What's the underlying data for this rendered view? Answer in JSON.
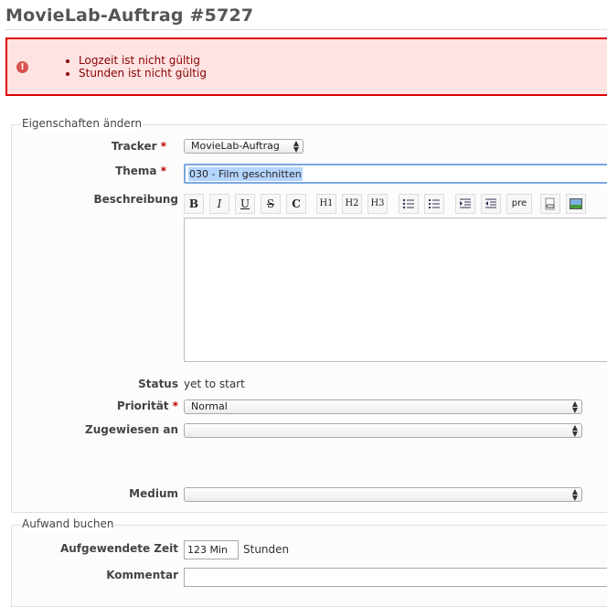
{
  "page": {
    "title": "MovieLab-Auftrag #5727"
  },
  "errors": [
    "Logzeit ist nicht gültig",
    "Stunden ist nicht gültig"
  ],
  "properties": {
    "legend": "Eigenschaften ändern",
    "tracker": {
      "label": "Tracker",
      "value": "MovieLab-Auftrag"
    },
    "subject": {
      "label": "Thema",
      "value": "030 - Film geschnitten"
    },
    "description": {
      "label": "Beschreibung",
      "value": ""
    },
    "toolbar": [
      "B",
      "I",
      "U",
      "S",
      "C",
      "H1",
      "H2",
      "H3",
      "ul",
      "ol",
      "indent",
      "outdent",
      "pre",
      "link",
      "image"
    ],
    "status": {
      "label": "Status",
      "value": "yet to start"
    },
    "priority": {
      "label": "Priorität",
      "value": "Normal"
    },
    "assignee": {
      "label": "Zugewiesen an",
      "value": ""
    },
    "medium": {
      "label": "Medium",
      "value": ""
    }
  },
  "time": {
    "legend": "Aufwand buchen",
    "spent": {
      "label": "Aufgewendete Zeit",
      "value": "123 Min",
      "unit": "Stunden"
    },
    "comment": {
      "label": "Kommentar",
      "value": ""
    }
  }
}
